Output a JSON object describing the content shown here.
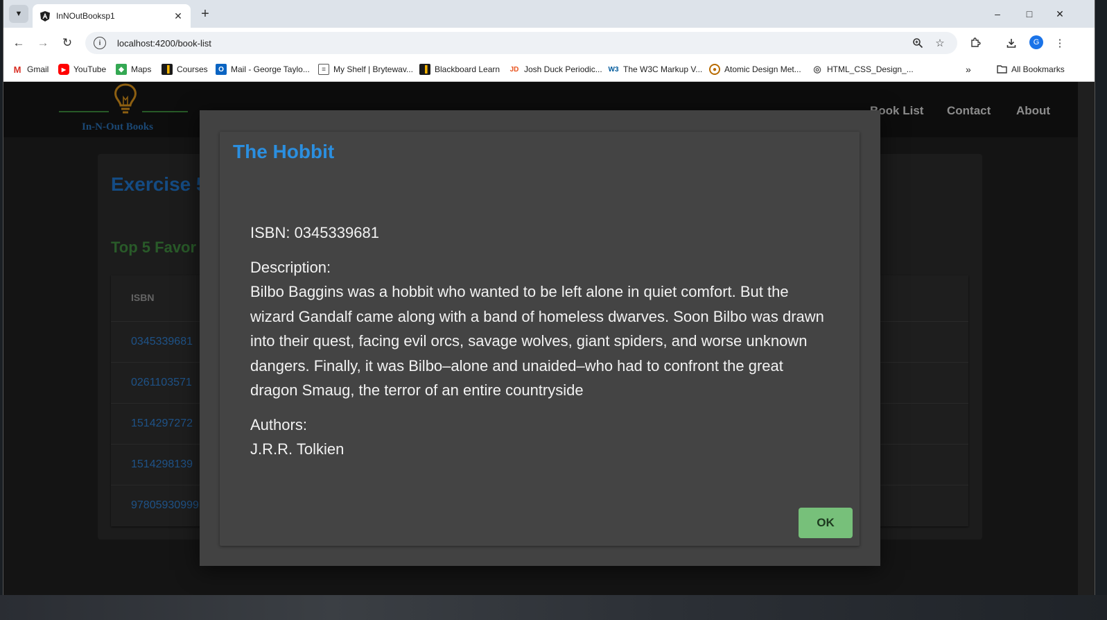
{
  "browser": {
    "tab_title": "InNOutBooksp1",
    "url": "localhost:4200/book-list",
    "bookmarks": [
      "Gmail",
      "YouTube",
      "Maps",
      "Courses",
      "Mail - George Taylo...",
      "My Shelf | Brytewav...",
      "Blackboard Learn",
      "Josh Duck Periodic...",
      "The W3C Markup V...",
      "Atomic Design Met...",
      "HTML_CSS_Design_..."
    ],
    "all_bookmarks": "All Bookmarks",
    "profile_initial": "G"
  },
  "site": {
    "logo_text": "In-N-Out Books",
    "nav": [
      "Book List",
      "Contact",
      "About"
    ]
  },
  "page": {
    "title": "Exercise 5",
    "subtitle": "Top 5 Favor",
    "table": {
      "header": "ISBN",
      "rows": [
        "0345339681",
        "0261103571",
        "1514297272",
        "1514298139",
        "97805930999"
      ]
    }
  },
  "dialog": {
    "title": "The Hobbit",
    "isbn_line": "ISBN: 0345339681",
    "description_label": "Description:",
    "description": "Bilbo Baggins was a hobbit who wanted to be left alone in quiet comfort. But the wizard Gandalf came along with a band of homeless dwarves. Soon Bilbo was drawn into their quest, facing evil orcs, savage wolves, giant spiders, and worse unknown dangers. Finally, it was Bilbo–alone and unaided–who had to confront the great dragon Smaug, the terror of an entire countryside",
    "authors_label": "Authors:",
    "authors": "J.R.R. Tolkien",
    "ok_label": "OK"
  },
  "colors": {
    "accent_blue": "#2b8fe0",
    "green_button": "#77c07a",
    "subtitle_green": "#3f8a3f"
  }
}
